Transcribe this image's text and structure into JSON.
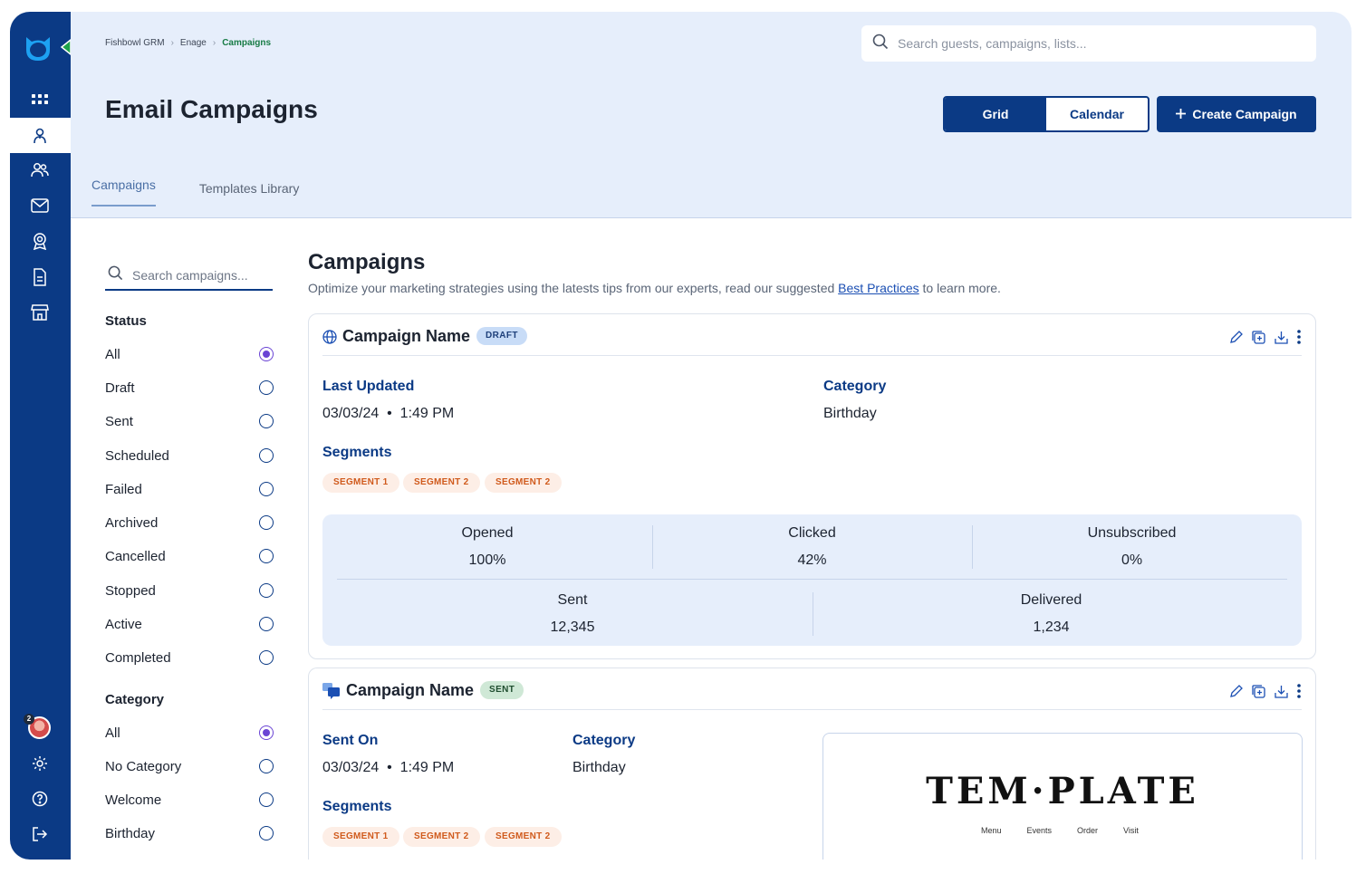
{
  "app": {
    "brand_icon": "fishbowl-logo-icon"
  },
  "sidebar": {
    "items": [
      {
        "icon": "apps-grid-icon"
      },
      {
        "icon": "marketing-icon",
        "active": true
      },
      {
        "icon": "users-icon"
      },
      {
        "icon": "mail-icon"
      },
      {
        "icon": "badge-icon"
      },
      {
        "icon": "document-icon"
      },
      {
        "icon": "store-icon"
      }
    ],
    "bottom": {
      "avatar_badge": "2",
      "items": [
        {
          "icon": "gear-icon"
        },
        {
          "icon": "help-icon"
        },
        {
          "icon": "logout-icon"
        }
      ]
    }
  },
  "header": {
    "breadcrumb": [
      "Fishbowl GRM",
      "Enage",
      "Campaigns"
    ],
    "title": "Email Campaigns",
    "search_placeholder": "Search guests, campaigns, lists...",
    "view_toggle": [
      "Grid",
      "Calendar"
    ],
    "create_label": "Create Campaign",
    "tabs": [
      "Campaigns",
      "Templates Library"
    ]
  },
  "filters": {
    "search_placeholder": "Search campaigns...",
    "status": {
      "heading": "Status",
      "options": [
        "All",
        "Draft",
        "Sent",
        "Scheduled",
        "Failed",
        "Archived",
        "Cancelled",
        "Stopped",
        "Active",
        "Completed"
      ],
      "selected": "All"
    },
    "category": {
      "heading": "Category",
      "options": [
        "All",
        "No Category",
        "Welcome",
        "Birthday"
      ],
      "selected": "All"
    }
  },
  "main": {
    "title": "Campaigns",
    "desc_before": "Optimize your marketing strategies using the latests tips from our experts, read our suggested ",
    "desc_link": "Best Practices",
    "desc_after": " to learn more.",
    "cards": [
      {
        "name": "Campaign Name",
        "status": "DRAFT",
        "date_label": "Last Updated",
        "date": "03/03/24",
        "time": "1:49 PM",
        "category_label": "Category",
        "category": "Birthday",
        "segments_label": "Segments",
        "segments": [
          "SEGMENT 1",
          "SEGMENT 2",
          "SEGMENT 2"
        ],
        "stats": {
          "opened_label": "Opened",
          "opened": "100%",
          "clicked_label": "Clicked",
          "clicked": "42%",
          "unsubscribed_label": "Unsubscribed",
          "unsubscribed": "0%",
          "sent_label": "Sent",
          "sent": "12,345",
          "delivered_label": "Delivered",
          "delivered": "1,234"
        }
      },
      {
        "name": "Campaign Name",
        "status": "SENT",
        "date_label": "Sent On",
        "date": "03/03/24",
        "time": "1:49 PM",
        "category_label": "Category",
        "category": "Birthday",
        "segments_label": "Segments",
        "segments": [
          "SEGMENT 1",
          "SEGMENT 2",
          "SEGMENT 2"
        ],
        "template": {
          "logo": "TEM·PLATE",
          "menu": [
            "Menu",
            "Events",
            "Order",
            "Visit"
          ]
        }
      }
    ]
  },
  "colors": {
    "primary": "#0b3a85",
    "header_bg": "#e6eefb",
    "accent_purple": "#6a44d4",
    "segment_orange": "#d05a1c",
    "breadcrumb_green": "#177b45"
  }
}
